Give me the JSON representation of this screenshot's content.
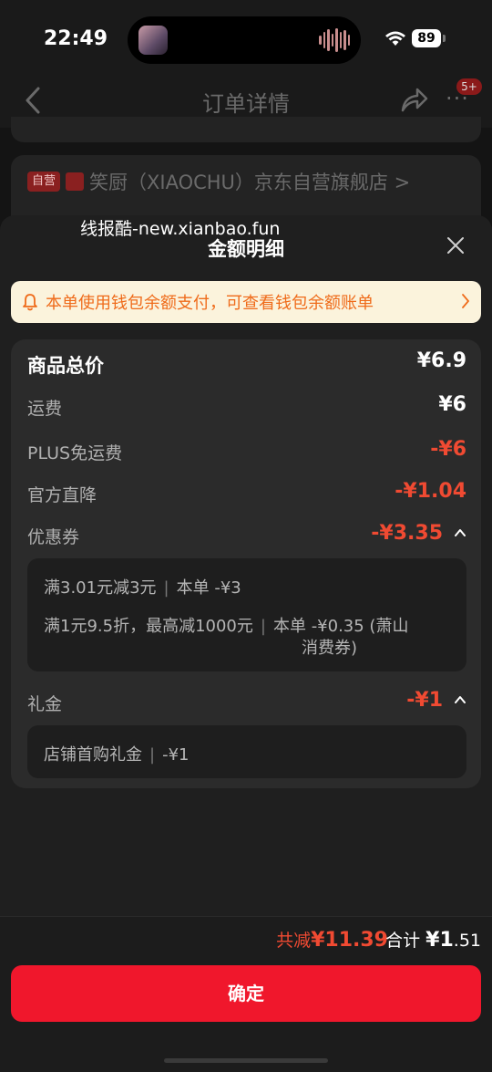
{
  "status_bar": {
    "time": "22:49",
    "battery": "89"
  },
  "header": {
    "title": "订单详情",
    "more": "···",
    "badge": "5+"
  },
  "store": {
    "tag": "自营",
    "name": "笑厨（XIAOCHU）京东自营旗舰店 >"
  },
  "sheet": {
    "watermark": "线报酷-new.xianbao.fun",
    "title": "金额明细"
  },
  "notice": {
    "text": "本单使用钱包余额支付，可查看钱包余额账单"
  },
  "rows": {
    "subtotal": {
      "label": "商品总价",
      "value": "¥6.9"
    },
    "shipping": {
      "label": "运费",
      "value": "¥6"
    },
    "plus_shipping": {
      "label": "PLUS免运费",
      "value": "-¥6"
    },
    "direct_discount": {
      "label": "官方直降",
      "value": "-¥1.04"
    },
    "coupon": {
      "label": "优惠券",
      "value": "-¥3.35"
    },
    "gift": {
      "label": "礼金",
      "value": "-¥1"
    }
  },
  "coupon_details": [
    {
      "desc": "满3.01元减3元",
      "sep": "|",
      "amount": "本单 -¥3"
    },
    {
      "desc": "满1元9.5折，最高减1000元",
      "sep": "|",
      "amount": "本单 -¥0.35 (萧山",
      "amount2": "消费券)"
    }
  ],
  "gift_details": [
    {
      "desc": "店铺首购礼金",
      "sep": "|",
      "amount": "-¥1"
    }
  ],
  "footer": {
    "reduce_label": "共减",
    "reduce_value": "¥11.39",
    "total_label": "合计",
    "total_currency": "¥",
    "total_int": "1",
    "total_dec": ".51",
    "confirm": "确定"
  },
  "colors": {
    "accent_red": "#f0172c",
    "discount_red": "#f04a32",
    "notice_orange": "#ef6b1a"
  }
}
